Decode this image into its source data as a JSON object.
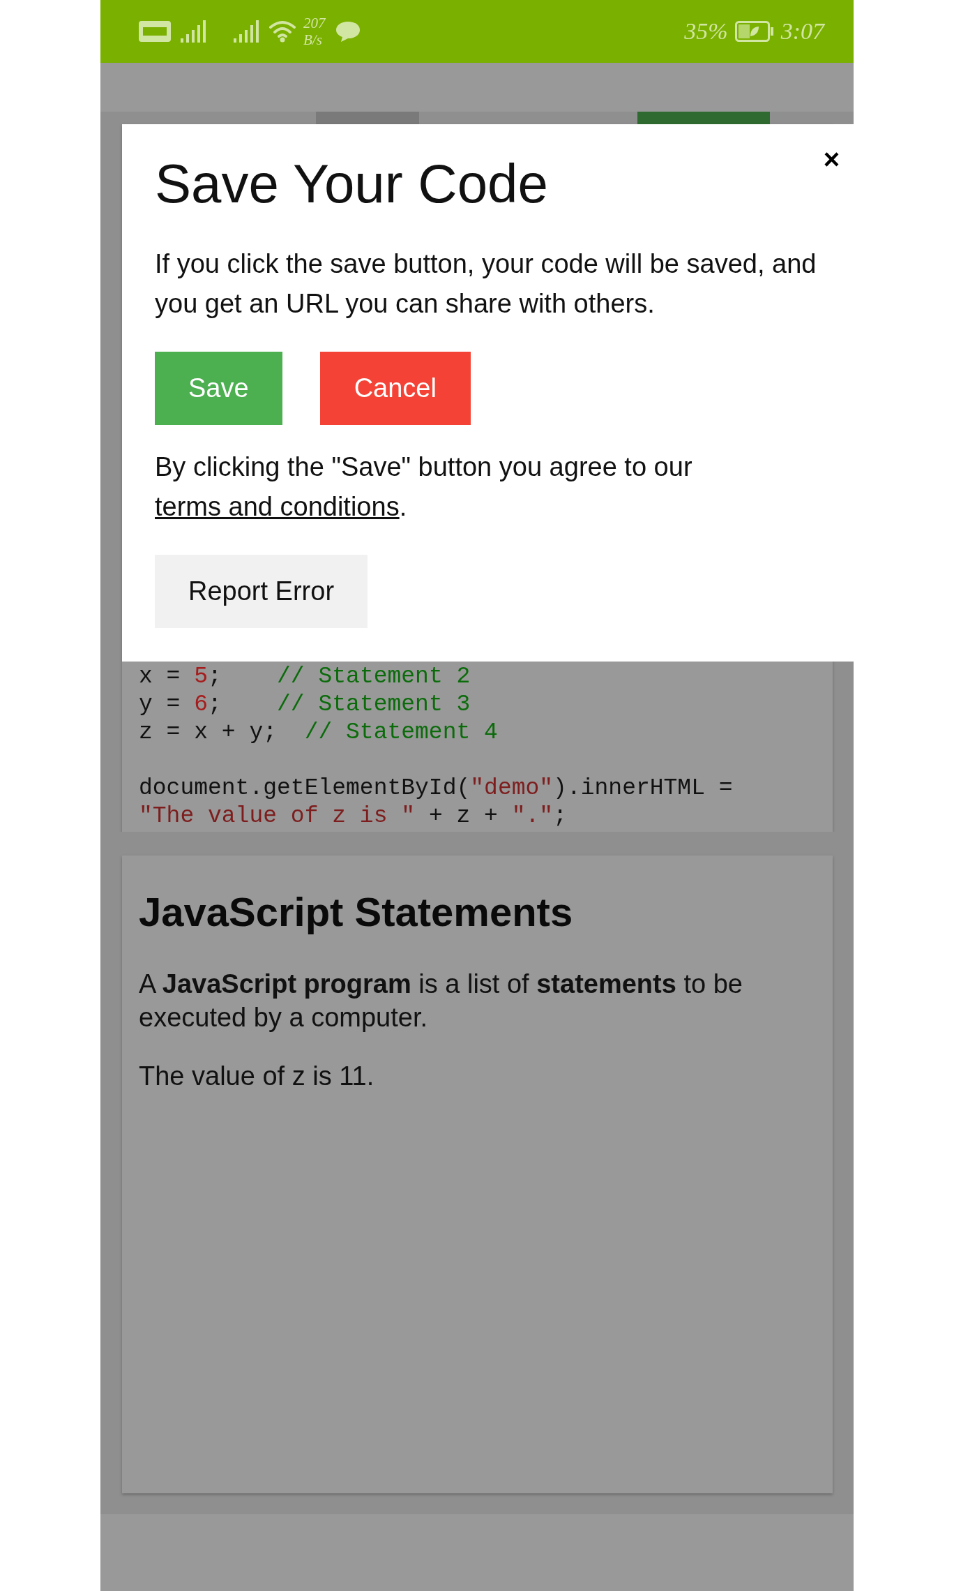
{
  "status_bar": {
    "speed_value": "207",
    "speed_unit": "B/s",
    "battery": "35%",
    "time": "3:07"
  },
  "toolbar": {
    "buttons": [
      {
        "kind": "neutral"
      },
      {
        "kind": "run"
      }
    ]
  },
  "code": {
    "lines": [
      {
        "kind": "code",
        "segments": [
          {
            "kind": "plain",
            "text": "x = "
          },
          {
            "kind": "number",
            "text": "5"
          },
          {
            "kind": "plain",
            "text": ";    "
          },
          {
            "kind": "comment",
            "text": "// Statement 2"
          }
        ]
      },
      {
        "kind": "code",
        "segments": [
          {
            "kind": "plain",
            "text": "y = "
          },
          {
            "kind": "number",
            "text": "6"
          },
          {
            "kind": "plain",
            "text": ";    "
          },
          {
            "kind": "comment",
            "text": "// Statement 3"
          }
        ]
      },
      {
        "kind": "code",
        "segments": [
          {
            "kind": "plain",
            "text": "z = x + y;  "
          },
          {
            "kind": "comment",
            "text": "// Statement 4"
          }
        ]
      },
      {
        "kind": "blank"
      },
      {
        "kind": "code",
        "segments": [
          {
            "kind": "plain",
            "text": "document.getElementById("
          },
          {
            "kind": "string",
            "text": "\"demo\""
          },
          {
            "kind": "plain",
            "text": ").innerHTML ="
          }
        ]
      },
      {
        "kind": "code",
        "segments": [
          {
            "kind": "string",
            "text": "\"The value of z is \""
          },
          {
            "kind": "plain",
            "text": " + z + "
          },
          {
            "kind": "string",
            "text": "\".\""
          },
          {
            "kind": "plain",
            "text": ";"
          }
        ]
      }
    ]
  },
  "result": {
    "heading": "JavaScript Statements",
    "paragraphs": [
      "A **JavaScript program** is a list of **statements** to be executed by a computer.",
      "The value of z is 11."
    ]
  },
  "dialog": {
    "title": "Save Your Code",
    "close": "×",
    "message": "If you click the save button, your code will be saved, and you get an URL you can share with others.",
    "buttons": [
      {
        "label": "Save",
        "kind": "primary"
      },
      {
        "label": "Cancel",
        "kind": "danger"
      }
    ],
    "terms": "By clicking the \"Save\" button you agree to our",
    "terms_link": "terms and conditions",
    "terms_end": ".",
    "report_button": "Report Error"
  }
}
